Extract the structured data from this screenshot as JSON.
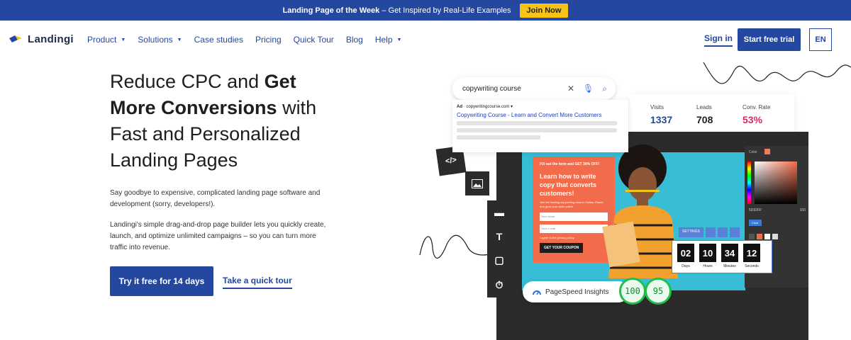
{
  "topbar": {
    "bold_text": "Landing Page of the Week",
    "text": " – Get Inspired by Real-Life Examples",
    "button": "Join Now"
  },
  "nav": {
    "logo": "Landingi",
    "links": [
      {
        "label": "Product",
        "dropdown": true
      },
      {
        "label": "Solutions",
        "dropdown": true
      },
      {
        "label": "Case studies",
        "dropdown": false
      },
      {
        "label": "Pricing",
        "dropdown": false
      },
      {
        "label": "Quick Tour",
        "dropdown": false
      },
      {
        "label": "Blog",
        "dropdown": false
      },
      {
        "label": "Help",
        "dropdown": true
      }
    ],
    "sign_in": "Sign in",
    "trial": "Start free trial",
    "lang": "EN"
  },
  "hero": {
    "title_a": "Reduce CPC and ",
    "title_b": "Get More Conversions",
    "title_c": " with Fast and Personalized Landing Pages",
    "para1": "Say goodbye to expensive, complicated landing page software and development (sorry, developers!).",
    "para2": "Landingi's simple drag-and-drop page builder lets you quickly create, launch, and optimize unlimited campaigns – so you can turn more traffic into revenue.",
    "cta_primary": "Try it free for 14 days",
    "cta_link": "Take a quick tour"
  },
  "visual": {
    "search_query": "copywriting course",
    "ad_label": "Ad",
    "ad_url": "copywritingcourse.com",
    "ad_title": "Copywriting Course - Learn and Convert More Customers",
    "stats": [
      {
        "label": "Visits",
        "value": "1337",
        "color": "#2447a0"
      },
      {
        "label": "Leads",
        "value": "708",
        "color": "#1e1e1e"
      },
      {
        "label": "Conv. Rate",
        "value": "53%",
        "color": "#e0245e"
      }
    ],
    "promo": {
      "small": "Fill out the form and GET 30% OFF!",
      "headline": "Learn how to write copy that converts customers!",
      "sub": "Join the leading copywriting class in Dallas. Reach and grow your skills online.",
      "field1": "Your name",
      "field2": "Your e-mail",
      "check": "I agree to the privacy policy",
      "button": "GET YOUR COUPON"
    },
    "color_panel": {
      "label": "Color",
      "hex": "5D92FF",
      "opacity": "100",
      "clear": "Clear"
    },
    "settings": "SETTINGS",
    "countdown": [
      {
        "value": "02",
        "label": "Days"
      },
      {
        "value": "10",
        "label": "Hours"
      },
      {
        "value": "34",
        "label": "Minutes"
      },
      {
        "value": "12",
        "label": "Seconds"
      }
    ],
    "pagespeed": "PageSpeed Insights",
    "scores": [
      "100",
      "95"
    ]
  },
  "colors": {
    "brand": "#2447a0",
    "accent_yellow": "#f6c417",
    "promo": "#f26b4a",
    "canvas": "#37bed6"
  }
}
